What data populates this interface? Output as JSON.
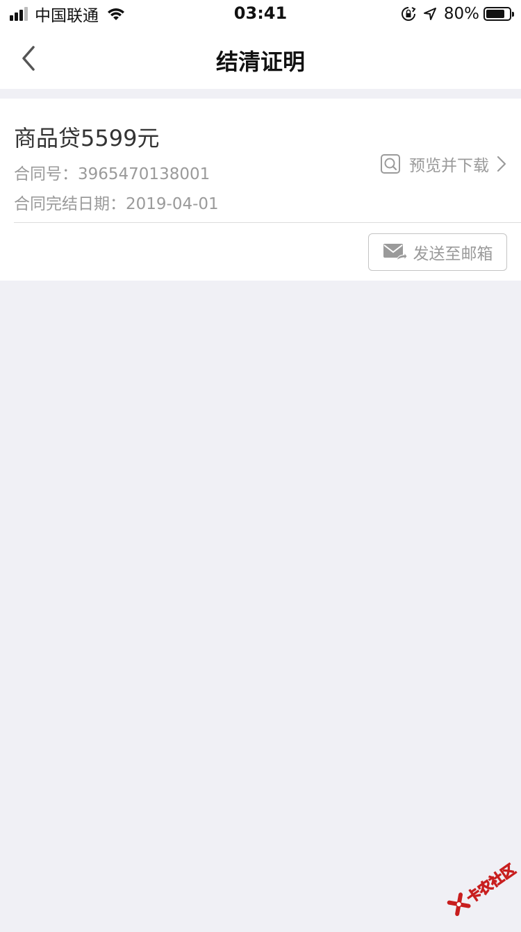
{
  "status_bar": {
    "carrier": "中国联通",
    "time": "03:41",
    "battery_percent": "80%",
    "battery_level": 0.8,
    "signal_bars": 3,
    "signal_bars_total": 4
  },
  "nav": {
    "title": "结清证明",
    "back_icon": "chevron-left-icon"
  },
  "certificate": {
    "product": "商品贷",
    "amount": "5599元",
    "contract_no_label": "合同号：",
    "contract_no": "3965470138001",
    "complete_date_label": "合同完结日期：",
    "complete_date": "2019-04-01",
    "preview_label": "预览并下载",
    "preview_icon": "search-document-icon",
    "email_label": "发送至邮箱",
    "email_icon": "mail-forward-icon"
  },
  "watermark": {
    "text": "卡农社区",
    "color": "#c81e1e"
  },
  "colors": {
    "background": "#f0f0f5",
    "card": "#ffffff",
    "secondary_text": "#9a9a9a"
  }
}
